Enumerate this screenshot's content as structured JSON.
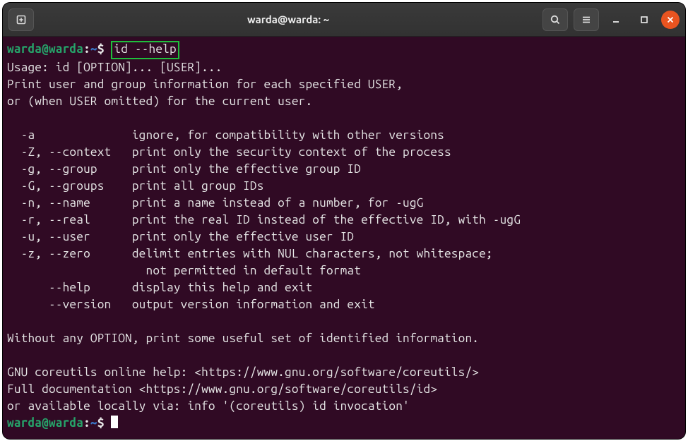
{
  "titlebar": {
    "title": "warda@warda: ~"
  },
  "prompt": {
    "userhost": "warda@warda",
    "sep": ":",
    "path": "~",
    "dollar": "$"
  },
  "cmd1_highlighted": "id --help",
  "output": {
    "l1": "Usage: id [OPTION]... [USER]...",
    "l2": "Print user and group information for each specified USER,",
    "l3": "or (when USER omitted) for the current user.",
    "l4": "",
    "l5": "  -a              ignore, for compatibility with other versions",
    "l6": "  -Z, --context   print only the security context of the process",
    "l7": "  -g, --group     print only the effective group ID",
    "l8": "  -G, --groups    print all group IDs",
    "l9": "  -n, --name      print a name instead of a number, for -ugG",
    "l10": "  -r, --real      print the real ID instead of the effective ID, with -ugG",
    "l11": "  -u, --user      print only the effective user ID",
    "l12": "  -z, --zero      delimit entries with NUL characters, not whitespace;",
    "l13": "                    not permitted in default format",
    "l14": "      --help      display this help and exit",
    "l15": "      --version   output version information and exit",
    "l16": "",
    "l17": "Without any OPTION, print some useful set of identified information.",
    "l18": "",
    "l19": "GNU coreutils online help: <https://www.gnu.org/software/coreutils/>",
    "l20": "Full documentation <https://www.gnu.org/software/coreutils/id>",
    "l21": "or available locally via: info '(coreutils) id invocation'"
  }
}
